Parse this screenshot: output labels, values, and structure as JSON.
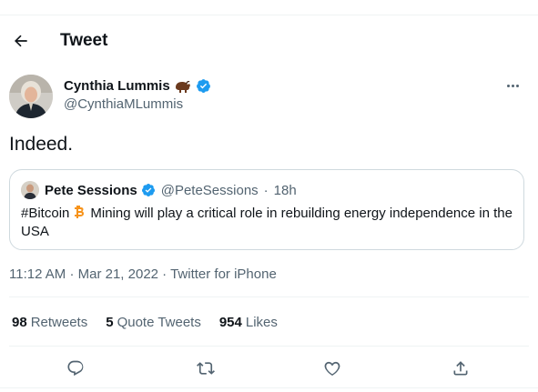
{
  "header": {
    "title": "Tweet",
    "back_icon": "arrow-left-icon"
  },
  "author": {
    "name": "Cynthia Lummis",
    "handle": "@CynthiaMLummis",
    "name_emoji_icon": "bison-icon",
    "verified_icon": "verified-badge-icon"
  },
  "tweet": {
    "text": "Indeed."
  },
  "quote": {
    "name": "Pete Sessions",
    "handle": "@PeteSessions",
    "separator": "·",
    "time": "18h",
    "hashtag": "#Bitcoin",
    "body": "Mining will play a critical role in rebuilding energy independence in the USA",
    "emoji_icon": "bitcoin-icon"
  },
  "meta": {
    "time": "11:12 AM",
    "separator": "·",
    "date": "Mar 21, 2022",
    "source": "Twitter for iPhone"
  },
  "stats": {
    "retweets": {
      "count": "98",
      "label": "Retweets"
    },
    "quotes": {
      "count": "5",
      "label": "Quote Tweets"
    },
    "likes": {
      "count": "954",
      "label": "Likes"
    }
  },
  "actions": [
    "reply-icon",
    "retweet-icon",
    "like-icon",
    "share-icon"
  ],
  "colors": {
    "verified": "#1d9bf0",
    "text": "#0f1419",
    "secondary": "#536471",
    "border": "#cfd9de",
    "bitcoin": "#f7931a"
  }
}
